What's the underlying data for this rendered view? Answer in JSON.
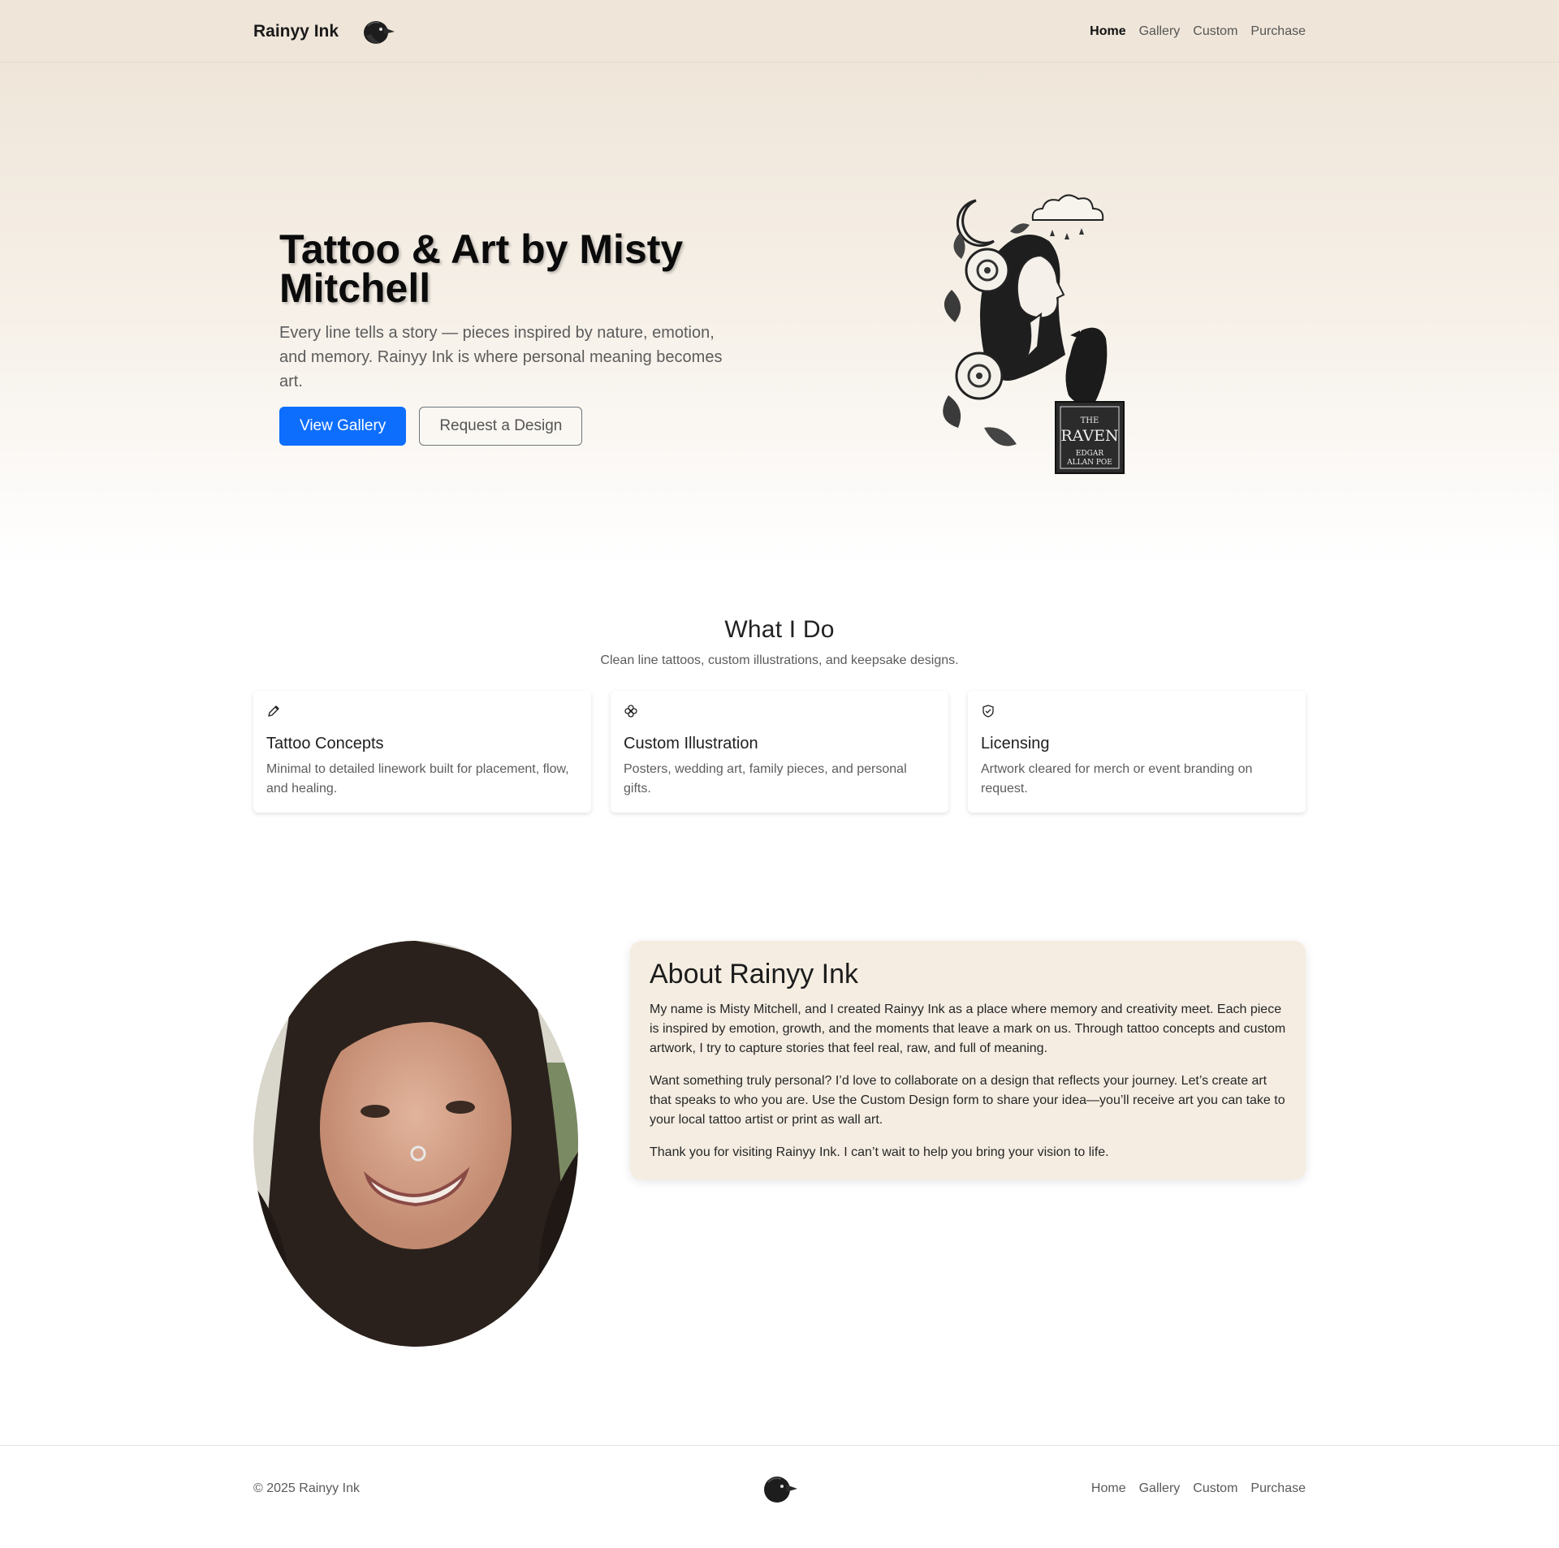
{
  "brand": {
    "name": "Rainyy Ink",
    "logo_icon": "raven-head-icon"
  },
  "nav": {
    "items": [
      {
        "label": "Home",
        "active": true
      },
      {
        "label": "Gallery",
        "active": false
      },
      {
        "label": "Custom",
        "active": false
      },
      {
        "label": "Purchase",
        "active": false
      }
    ]
  },
  "hero": {
    "title": "Tattoo & Art by Misty Mitchell",
    "subtitle": "Every line tells a story — pieces inspired by nature, emotion, and memory. Rainyy Ink is where personal meaning becomes art.",
    "primary_button": "View Gallery",
    "secondary_button": "Request a Design",
    "art_book_text": {
      "line1": "THE",
      "line2": "RAVEN",
      "line3": "EDGAR",
      "line4": "ALLAN POE"
    }
  },
  "services": {
    "title": "What I Do",
    "subtitle": "Clean line tattoos, custom illustrations, and keepsake designs.",
    "cards": [
      {
        "icon": "pencil-icon",
        "title": "Tattoo Concepts",
        "text": "Minimal to detailed linework built for placement, flow, and healing."
      },
      {
        "icon": "flower-icon",
        "title": "Custom Illustration",
        "text": "Posters, wedding art, family pieces, and personal gifts."
      },
      {
        "icon": "shield-check-icon",
        "title": "Licensing",
        "text": "Artwork cleared for merch or event branding on request."
      }
    ]
  },
  "about": {
    "title": "About Rainyy Ink",
    "paragraphs": [
      "My name is Misty Mitchell, and I created Rainyy Ink as a place where memory and creativity meet. Each piece is inspired by emotion, growth, and the moments that leave a mark on us. Through tattoo concepts and custom artwork, I try to capture stories that feel real, raw, and full of meaning.",
      "Want something truly personal? I’d love to collaborate on a design that reflects your journey. Let’s create art that speaks to who you are. Use the Custom Design form to share your idea—you’ll receive art you can take to your local tattoo artist or print as wall art.",
      "Thank you for visiting Rainyy Ink. I can’t wait to help you bring your vision to life."
    ]
  },
  "footer": {
    "copyright": "© 2025 Rainyy Ink",
    "links": [
      "Home",
      "Gallery",
      "Custom",
      "Purchase"
    ]
  },
  "colors": {
    "accent": "#0d6efd",
    "nav_bg": "#efe6d9",
    "about_bg": "#f5ede2"
  }
}
